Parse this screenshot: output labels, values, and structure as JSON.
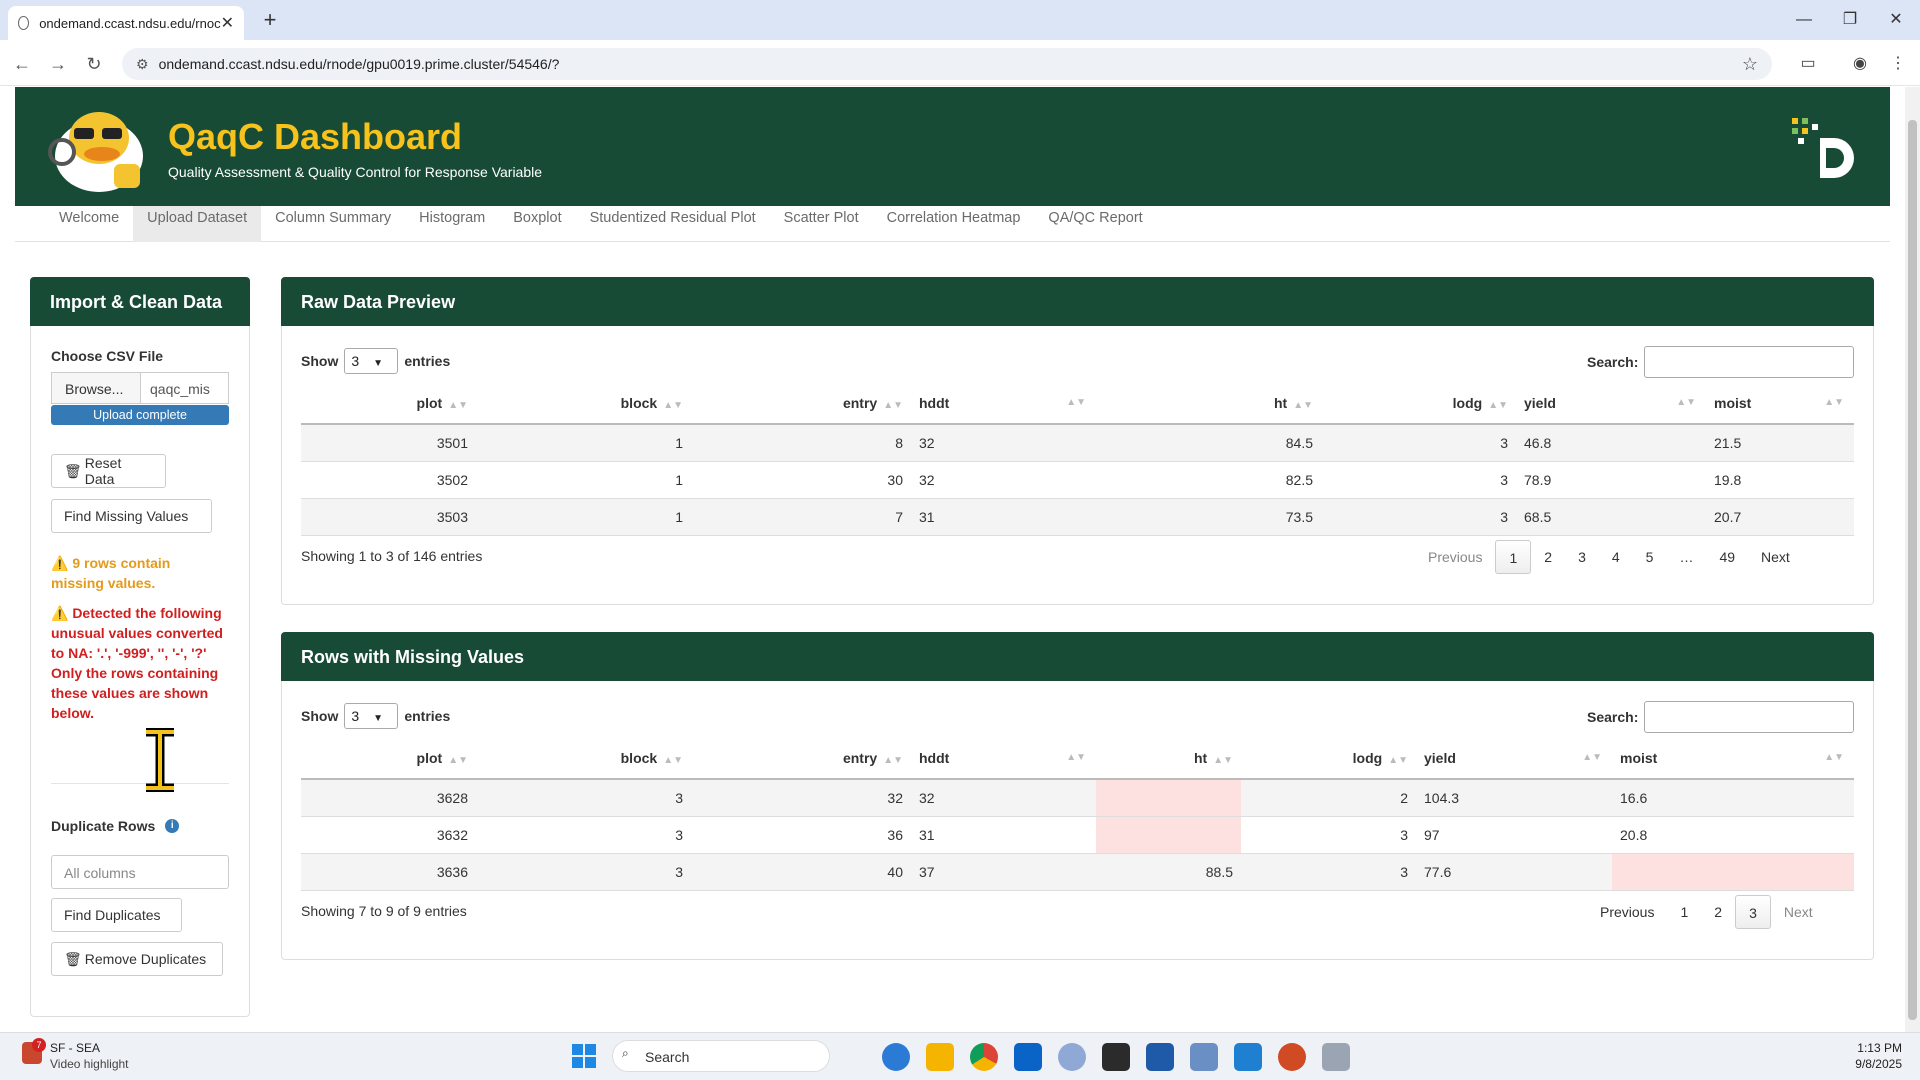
{
  "browser": {
    "tab_title": "ondemand.ccast.ndsu.edu/rnoc",
    "url": "ondemand.ccast.ndsu.edu/rnode/gpu0019.prime.cluster/54546/?"
  },
  "header": {
    "title": "QaqC Dashboard",
    "subtitle": "Quality Assessment & Quality Control for Response Variable"
  },
  "nav": [
    "Welcome",
    "Upload Dataset",
    "Column Summary",
    "Histogram",
    "Boxplot",
    "Studentized Residual Plot",
    "Scatter Plot",
    "Correlation Heatmap",
    "QA/QC Report"
  ],
  "sidebar": {
    "title": "Import & Clean Data",
    "file_label": "Choose CSV File",
    "browse_label": "Browse...",
    "filename": "qaqc_mis",
    "progress_label": "Upload complete",
    "reset_label": "Reset Data",
    "find_missing_label": "Find Missing Values",
    "warning_rows": "⚠️ 9 rows contain missing values.",
    "warning_line1": "⚠️ Detected the following unusual values converted to NA: '.', '-999', '', '-', '?'",
    "warning_line2": "Only the rows containing these values are shown below.",
    "duplicate_label": "Duplicate Rows",
    "duplicate_placeholder": "All columns",
    "find_duplicates_label": "Find Duplicates",
    "remove_duplicates_label": "Remove Duplicates"
  },
  "columns": [
    "plot",
    "block",
    "entry",
    "hddt",
    "ht",
    "lodg",
    "yield",
    "moist"
  ],
  "raw_preview": {
    "title": "Raw Data Preview",
    "show_label": "Show",
    "entries_label": "entries",
    "page_size": "3",
    "search_label": "Search:",
    "rows": [
      [
        "3501",
        "1",
        "8",
        "32",
        "84.5",
        "3",
        "46.8",
        "21.5"
      ],
      [
        "3502",
        "1",
        "30",
        "32",
        "82.5",
        "3",
        "78.9",
        "19.8"
      ],
      [
        "3503",
        "1",
        "7",
        "31",
        "73.5",
        "3",
        "68.5",
        "20.7"
      ]
    ],
    "info": "Showing 1 to 3 of 146 entries",
    "pager": [
      "Previous",
      "1",
      "2",
      "3",
      "4",
      "5",
      "…",
      "49",
      "Next"
    ]
  },
  "missing_rows": {
    "title": "Rows with Missing Values",
    "show_label": "Show",
    "entries_label": "entries",
    "page_size": "3",
    "search_label": "Search:",
    "rows": [
      [
        "3628",
        "3",
        "32",
        "32",
        "",
        "2",
        "104.3",
        "16.6"
      ],
      [
        "3632",
        "3",
        "36",
        "31",
        "",
        "3",
        "97",
        "20.8"
      ],
      [
        "3636",
        "3",
        "40",
        "37",
        "88.5",
        "3",
        "77.6",
        ""
      ]
    ],
    "info": "Showing 7 to 9 of 9 entries",
    "pager": [
      "Previous",
      "1",
      "2",
      "3",
      "Next"
    ]
  },
  "taskbar": {
    "weather_badge": "7",
    "weather_title": "SF - SEA",
    "weather_subtitle": "Video highlight",
    "search_placeholder": "Search",
    "time": "1:13 PM",
    "date": "9/8/2025"
  },
  "colors": {
    "header_green": "#184b36",
    "title_gold": "#f6c21b",
    "missing_highlight": "#fde0e0",
    "warning_orange": "#e49a1b",
    "warning_red": "#d11f1f",
    "progress_blue": "#337ab7"
  }
}
